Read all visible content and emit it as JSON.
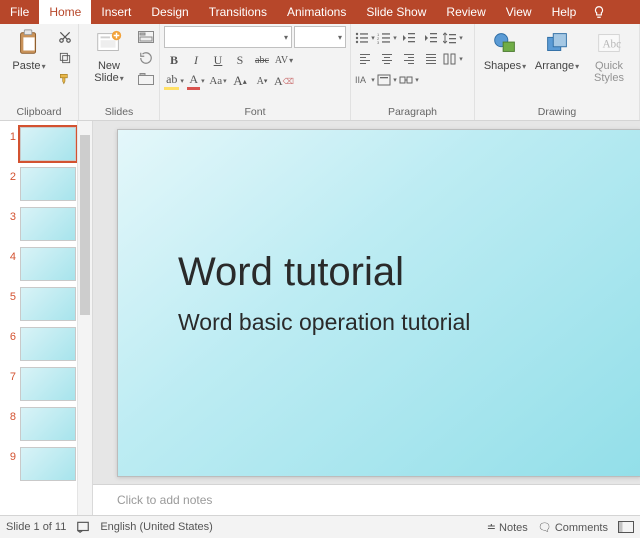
{
  "titlebar": {
    "tabs": [
      "File",
      "Home",
      "Insert",
      "Design",
      "Transitions",
      "Animations",
      "Slide Show",
      "Review",
      "View",
      "Help"
    ],
    "active_index": 1,
    "tell_me_icon": "lightbulb"
  },
  "ribbon": {
    "clipboard": {
      "label": "Clipboard",
      "paste": "Paste"
    },
    "slides": {
      "label": "Slides",
      "new_slide": "New\nSlide"
    },
    "font": {
      "label": "Font",
      "font_name": "",
      "font_size": "",
      "buttons_row1": [
        "B",
        "I",
        "U",
        "S",
        "abc",
        "AV"
      ],
      "buttons_row2": [
        "A",
        "A",
        "Aa",
        "A▲",
        "A▼",
        "A"
      ]
    },
    "paragraph": {
      "label": "Paragraph"
    },
    "drawing": {
      "label": "Drawing",
      "shapes": "Shapes",
      "arrange": "Arrange",
      "styles": "Quick\nStyles"
    }
  },
  "thumbnails": {
    "count": 9,
    "selected": 1
  },
  "slide": {
    "title": "Word tutorial",
    "subtitle": "Word basic operation tutorial"
  },
  "notes": {
    "placeholder": "Click to add notes"
  },
  "status": {
    "slide_pos": "Slide 1 of 11",
    "language": "English (United States)",
    "notes_btn": "Notes",
    "comments_btn": "Comments"
  }
}
